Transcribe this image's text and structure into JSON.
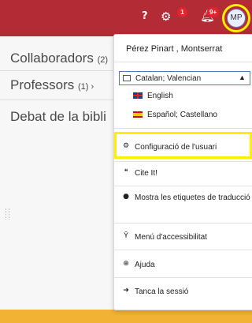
{
  "header": {
    "help_label": "?",
    "gear_badge": "1",
    "bell_badge": "9+",
    "avatar_initials": "MP",
    "icons": [
      "help-icon",
      "gear-icon",
      "bell-icon"
    ]
  },
  "content": {
    "rows": [
      {
        "label": "Collaboradors",
        "count": "(2)"
      },
      {
        "label": "Professors",
        "count": "(1) ›"
      },
      {
        "label": "Debat de la bibli",
        "count": ""
      }
    ]
  },
  "menu": {
    "user_name": "Pérez Pinart , Montserrat",
    "language_selected": "Catalan; Valencian",
    "languages": [
      "English",
      "Español; Castellano"
    ],
    "items": [
      {
        "icon": "gear-icon",
        "label": "Configuració de l'usuari"
      },
      {
        "icon": "quote-icon",
        "label": "Cite It!"
      },
      {
        "icon": "globe-icon",
        "label": "Mostra les etiquetes de traducció"
      },
      {
        "icon": "accessibility-icon",
        "label": "Menú d'accessibilitat"
      },
      {
        "icon": "lifebuoy-icon",
        "label": "Ajuda"
      },
      {
        "icon": "logout-icon",
        "label": "Tanca la sessió"
      }
    ]
  },
  "colors": {
    "header_bg": "#b32b35",
    "highlight": "#ffef00",
    "frame_bg": "#f2b233"
  }
}
